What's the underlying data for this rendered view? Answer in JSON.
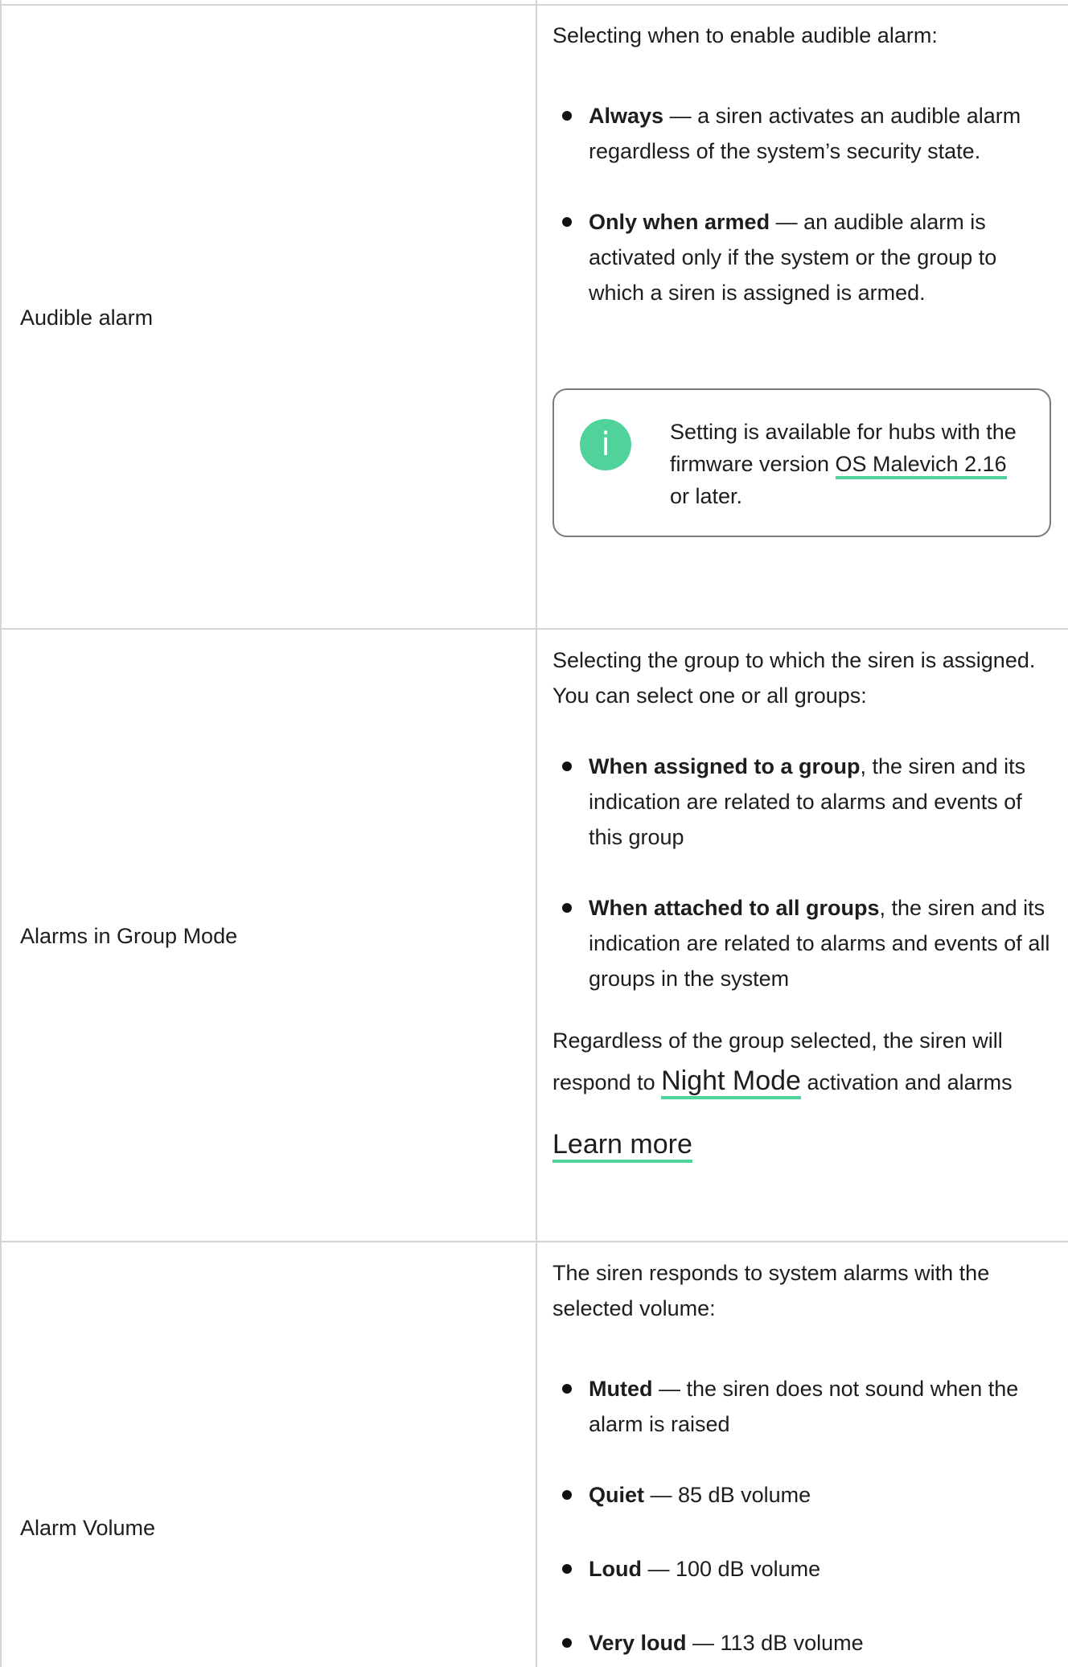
{
  "rows": [
    {
      "label": "Audible alarm",
      "intro": "Selecting when to enable audible alarm:",
      "bullets": [
        {
          "term": "Always",
          "text": " — a siren activates an audible alarm regardless of the system’s security state."
        },
        {
          "term": "Only when armed",
          "text": " — an audible alarm is activated only if the system or the group to which a siren is assigned is armed."
        }
      ],
      "note": {
        "icon": "info-icon",
        "icon_glyph": "i",
        "text_before": "Setting is available for hubs with the firmware version ",
        "link": "OS Malevich 2.16",
        "text_after": " or later."
      }
    },
    {
      "label": "Alarms in Group Mode",
      "intro": "Selecting the group to which the siren is assigned. You can select one or all groups:",
      "bullets": [
        {
          "term": "When assigned to a group",
          "text": ", the siren and its indication are related to alarms and events of this group"
        },
        {
          "term": "When attached to all groups",
          "text": ", the siren and its indication are related to alarms and events of all groups in the system"
        }
      ],
      "outro_before": "Regardless of the group selected, the siren will respond to ",
      "outro_link": "Night Mode",
      "outro_after": " activation and alarms",
      "learn_more": "Learn more"
    },
    {
      "label": "Alarm Volume",
      "intro": "The siren responds to system alarms with the selected volume:",
      "bullets": [
        {
          "term": "Muted",
          "text": " — the siren does not sound when the alarm is raised"
        },
        {
          "term": "Quiet",
          "text": " — 85 dB volume"
        },
        {
          "term": "Loud",
          "text": " — 100 dB volume"
        },
        {
          "term": "Very loud",
          "text": " — 113 dB volume"
        }
      ]
    }
  ],
  "colors": {
    "accent": "#4fd39a",
    "border": "#d4d4d4"
  }
}
